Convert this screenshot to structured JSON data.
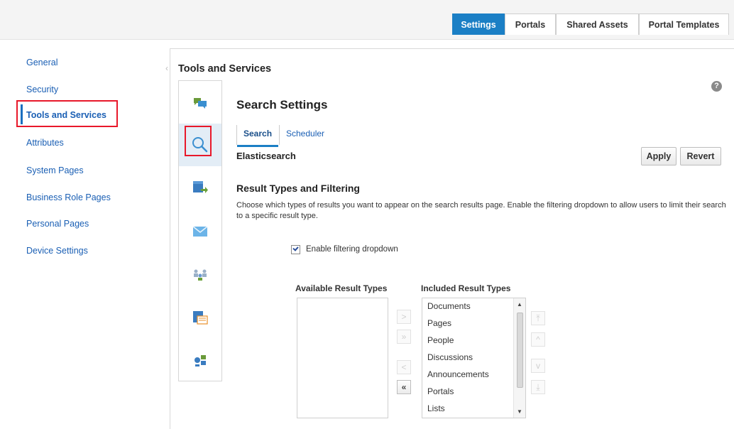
{
  "top_tabs": [
    "Settings",
    "Portals",
    "Shared Assets",
    "Portal Templates"
  ],
  "sidebar": {
    "items": [
      "General",
      "Security",
      "Tools and Services",
      "Attributes",
      "System Pages",
      "Business Role Pages",
      "Personal Pages",
      "Device Settings"
    ],
    "selected": "Tools and Services"
  },
  "page_title": "Tools and Services",
  "rail": {
    "icons": [
      "discussions-icon",
      "search-icon",
      "documents-icon",
      "mail-icon",
      "people-connections-icon",
      "lists-icon",
      "events-icon"
    ],
    "active": "search-icon"
  },
  "section": {
    "title": "Search Settings",
    "tabs": [
      "Search",
      "Scheduler"
    ],
    "active_tab": "Search",
    "engine": "Elasticsearch",
    "apply_label": "Apply",
    "revert_label": "Revert",
    "help_label": "?",
    "heading": "Result Types and Filtering",
    "description": "Choose which types of results you want to appear on the search results page. Enable the filtering dropdown to allow users to limit their search to a specific result type.",
    "filter_checkbox_label": "Enable filtering dropdown",
    "filter_checkbox_checked": true,
    "available_heading": "Available Result Types",
    "available_items": [],
    "included_heading": "Included Result Types",
    "included_items": [
      "Documents",
      "Pages",
      "People",
      "Discussions",
      "Announcements",
      "Portals",
      "Lists"
    ],
    "shuttle": {
      "move": ">",
      "move_all": "»",
      "remove": "<",
      "remove_all": "«"
    },
    "reorder": {
      "top": "⤒",
      "up": "^",
      "down": "v",
      "bottom": "⤓"
    }
  },
  "colors": {
    "accent": "#1b7fc5",
    "link": "#1a5fb4",
    "highlight": "#e8182a",
    "active_bg": "#e3edf6"
  }
}
